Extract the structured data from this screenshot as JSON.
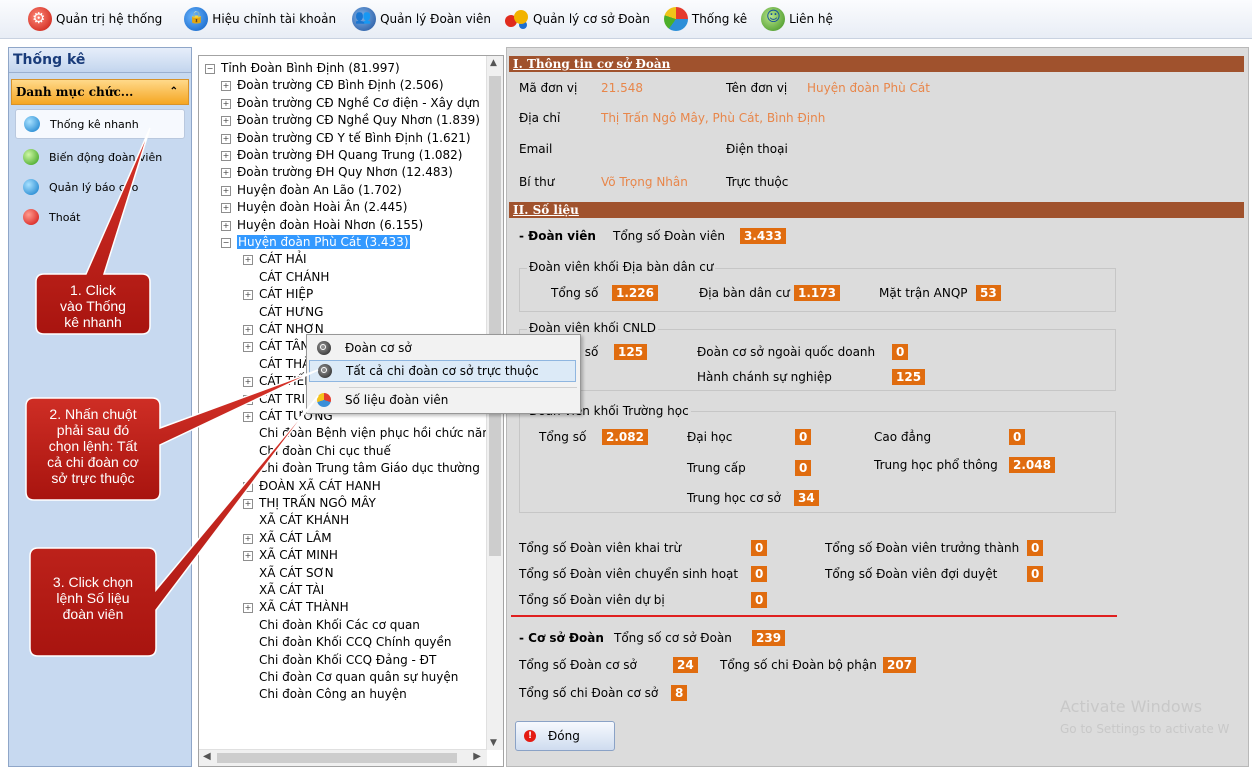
{
  "toolbar": [
    {
      "label": "Quản trị hệ thống",
      "icon": "gear-icon"
    },
    {
      "label": "Hiệu chỉnh tài khoản",
      "icon": "lock-icon"
    },
    {
      "label": "Quản lý Đoàn viên",
      "icon": "users-icon"
    },
    {
      "label": "Quản lý cơ sở Đoàn",
      "icon": "shapes-icon"
    },
    {
      "label": "Thống kê",
      "icon": "pie-chart-icon"
    },
    {
      "label": "Liên hệ",
      "icon": "contact-icon"
    }
  ],
  "left_panel": {
    "title": "Thống kê",
    "section": "Danh mục chức...",
    "items": [
      {
        "label": "Thống kê nhanh",
        "icon": "blue"
      },
      {
        "label": "Biến động đoàn viên",
        "icon": "green"
      },
      {
        "label": "Quản lý báo cáo",
        "icon": "blue"
      },
      {
        "label": "Thoát",
        "icon": "red"
      }
    ]
  },
  "tree": {
    "rows": [
      {
        "label": "Tỉnh Đoàn Bình Định (81.997)",
        "level": 0,
        "expander": "−"
      },
      {
        "label": "Đoàn trường CĐ Bình Định (2.506)",
        "level": 1,
        "expander": "+"
      },
      {
        "label": "Đoàn trường CĐ Nghề Cơ điện - Xây dựn",
        "level": 1,
        "expander": "+"
      },
      {
        "label": "Đoàn trường CĐ Nghề Quy Nhơn (1.839)",
        "level": 1,
        "expander": "+"
      },
      {
        "label": "Đoàn trường CĐ Y tế Bình Định (1.621)",
        "level": 1,
        "expander": "+"
      },
      {
        "label": "Đoàn trường ĐH Quang Trung (1.082)",
        "level": 1,
        "expander": "+"
      },
      {
        "label": "Đoàn trường ĐH Quy Nhơn (12.483)",
        "level": 1,
        "expander": "+"
      },
      {
        "label": "Huyện đoàn An Lão (1.702)",
        "level": 1,
        "expander": "+"
      },
      {
        "label": "Huyện đoàn Hoài Ân (2.445)",
        "level": 1,
        "expander": "+"
      },
      {
        "label": "Huyện đoàn Hoài Nhơn (6.155)",
        "level": 1,
        "expander": "+"
      },
      {
        "label": "Huyện đoàn Phù Cát (3.433)",
        "level": 1,
        "expander": "−",
        "selected": true
      },
      {
        "label": "CÁT HẢI",
        "level": 2,
        "expander": "+"
      },
      {
        "label": "CÁT CHÁNH",
        "level": 2,
        "expander": ""
      },
      {
        "label": "CÁT HIỆP",
        "level": 2,
        "expander": "+"
      },
      {
        "label": "CÁT HƯNG",
        "level": 2,
        "expander": ""
      },
      {
        "label": "CÁT NHƠN",
        "level": 2,
        "expander": "+"
      },
      {
        "label": "CÁT TÂN",
        "level": 2,
        "expander": "+"
      },
      {
        "label": "CÁT THÀNH",
        "level": 2,
        "expander": ""
      },
      {
        "label": "CÁT TIẾN",
        "level": 2,
        "expander": "+"
      },
      {
        "label": "CÁT TRINH",
        "level": 2,
        "expander": "+"
      },
      {
        "label": "CÁT TƯỜNG",
        "level": 2,
        "expander": "+"
      },
      {
        "label": "Chi đoàn Bệnh viện phục hồi chức năn",
        "level": 2,
        "expander": ""
      },
      {
        "label": "Chi đoàn Chi cục thuế",
        "level": 2,
        "expander": ""
      },
      {
        "label": "Chi đoàn Trung tâm Giáo dục thường",
        "level": 2,
        "expander": ""
      },
      {
        "label": "ĐOÀN XÃ CÁT HANH",
        "level": 2,
        "expander": "+"
      },
      {
        "label": "THỊ TRẤN NGÔ MÂY",
        "level": 2,
        "expander": "+"
      },
      {
        "label": "XÃ CÁT KHÁNH",
        "level": 2,
        "expander": ""
      },
      {
        "label": "XÃ CÁT LÂM",
        "level": 2,
        "expander": "+"
      },
      {
        "label": "XÃ CÁT MINH",
        "level": 2,
        "expander": "+"
      },
      {
        "label": "XÃ CÁT SƠN",
        "level": 2,
        "expander": ""
      },
      {
        "label": "XÃ CÁT TÀI",
        "level": 2,
        "expander": ""
      },
      {
        "label": "XÃ CÁT THÀNH",
        "level": 2,
        "expander": "+"
      },
      {
        "label": "Chi đoàn Khối Các cơ quan",
        "level": 2,
        "expander": ""
      },
      {
        "label": "Chi đoàn Khối CCQ Chính quyền",
        "level": 2,
        "expander": ""
      },
      {
        "label": "Chi đoàn Khối CCQ Đảng - ĐT",
        "level": 2,
        "expander": ""
      },
      {
        "label": "Chi đoàn Cơ quan quân sự huyện",
        "level": 2,
        "expander": ""
      },
      {
        "label": "Chi đoàn Công an huyện",
        "level": 2,
        "expander": ""
      }
    ]
  },
  "context_menu": [
    {
      "label": "Đoàn cơ sở",
      "icon": "search-icon"
    },
    {
      "label": "Tất cả chi đoàn cơ sở trực thuộc",
      "icon": "search-icon",
      "highlighted": true
    },
    {
      "label": "Số liệu đoàn viên",
      "icon": "pie-chart-icon"
    }
  ],
  "info": {
    "section_title": "I. Thông tin cơ sở Đoàn",
    "ma_don_vi_label": "Mã đơn vị",
    "ma_don_vi": "21.548",
    "ten_don_vi_label": "Tên đơn vị",
    "ten_don_vi": "Huyện đoàn Phù Cát",
    "dia_chi_label": "Địa chỉ",
    "dia_chi": "Thị Trấn Ngô Mây, Phù Cát, Bình Định",
    "email_label": "Email",
    "dien_thoai_label": "Điện thoại",
    "bi_thu_label": "Bí thư",
    "bi_thu": "Võ Trọng Nhân",
    "truc_thuoc_label": "Trực thuộc"
  },
  "stats": {
    "section_title": "II. Số liệu",
    "doan_vien_heading": "- Đoàn viên",
    "tong_so_doan_vien_label": "Tổng số Đoàn viên",
    "tong_so_doan_vien": "3.433",
    "dia_ban": {
      "title": "Đoàn viên khối Địa bàn dân cư",
      "tong_so_label": "Tổng số",
      "tong_so": "1.226",
      "dia_ban_label": "Địa bàn dân cư",
      "dia_ban": "1.173",
      "mat_tran_label": "Mặt trận ANQP",
      "mat_tran": "53"
    },
    "cnld": {
      "title": "Đoàn viên khối CNLD",
      "tong_so_label": "Tổng số",
      "tong_so": "125",
      "ngoai_qd_label": "Đoàn cơ sở ngoài quốc doanh",
      "ngoai_qd": "0",
      "hcsn_label": "Hành chánh sự nghiệp",
      "hcsn": "125"
    },
    "truong_hoc": {
      "title": "Đoàn viên khối Trường học",
      "tong_so_label": "Tổng số",
      "tong_so": "2.082",
      "dai_hoc_label": "Đại học",
      "dai_hoc": "0",
      "cao_dang_label": "Cao đẳng",
      "cao_dang": "0",
      "trung_cap_label": "Trung cấp",
      "trung_cap": "0",
      "thpt_label": "Trung học phổ thông",
      "thpt": "2.048",
      "thcs_label": "Trung học cơ sở",
      "thcs": "34"
    },
    "khai_tru_label": "Tổng số Đoàn viên khai trừ",
    "khai_tru": "0",
    "truong_thanh_label": "Tổng số Đoàn viên trưởng thành",
    "truong_thanh": "0",
    "chuyen_sh_label": "Tổng số Đoàn viên chuyển sinh hoạt",
    "chuyen_sh": "0",
    "doi_duyet_label": "Tổng số Đoàn viên đợi duyệt",
    "doi_duyet": "0",
    "du_bi_label": "Tổng số Đoàn viên dự bị",
    "du_bi": "0",
    "co_so_heading": "- Cơ sở Đoàn",
    "tong_co_so_label": "Tổng số cơ sở Đoàn",
    "tong_co_so": "239",
    "doan_co_so_label": "Tổng số Đoàn cơ sở",
    "doan_co_so": "24",
    "chi_doan_bp_label": "Tổng số chi Đoàn bộ phận",
    "chi_doan_bp": "207",
    "chi_doan_cs_label": "Tổng số chi Đoàn cơ sở",
    "chi_doan_cs": "8"
  },
  "close_button": "Đóng",
  "watermark": {
    "line1": "Activate Windows",
    "line2": "Go to Settings to activate W"
  },
  "callouts": [
    "1. Click\nvào Thống\nkê nhanh",
    "2. Nhấn chuột\nphải sau đó\nchọn lệnh: Tất\ncả chi đoàn cơ\nsở trực thuộc",
    "3. Click chọn\nlệnh Số liệu\nđoàn viên"
  ],
  "colors": {
    "accent_badge": "#e06c0f",
    "section_header": "#a0522d",
    "callout_fill": "#c0201a",
    "selection": "#3399ff"
  }
}
